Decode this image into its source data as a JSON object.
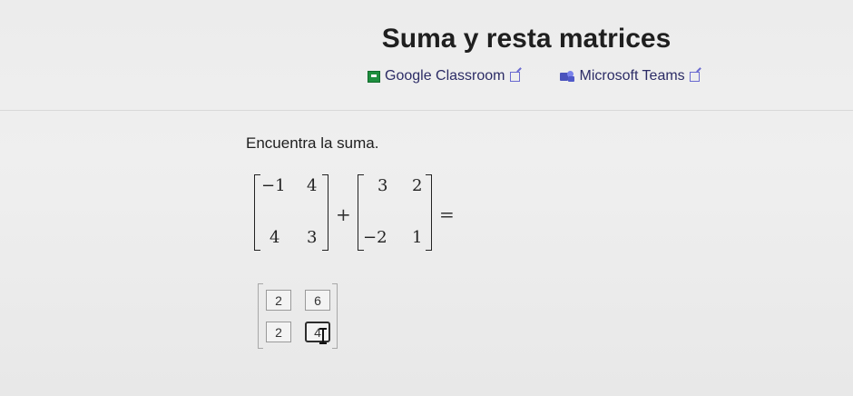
{
  "page": {
    "title": "Suma y resta matrices"
  },
  "share": {
    "google_classroom": {
      "label": "Google Classroom",
      "icon": "google-classroom-icon",
      "ext_icon": "external-link-icon"
    },
    "microsoft_teams": {
      "label": "Microsoft Teams",
      "icon": "microsoft-teams-icon",
      "ext_icon": "external-link-icon"
    }
  },
  "exercise": {
    "prompt": "Encuentra la suma.",
    "matrix_a": [
      [
        "−1",
        "4"
      ],
      [
        "4",
        "3"
      ]
    ],
    "matrix_b": [
      [
        "3",
        "2"
      ],
      [
        "−2",
        "1"
      ]
    ],
    "plus": "+",
    "equals": "="
  },
  "answer": {
    "values": [
      [
        "2",
        "6"
      ],
      [
        "2",
        "4"
      ]
    ],
    "active_cell": "r2c2"
  },
  "colors": {
    "background": "#ececec",
    "link": "#2c2c66",
    "classroom_green": "#1e8e3e",
    "teams_purple": "#4b53bc"
  }
}
